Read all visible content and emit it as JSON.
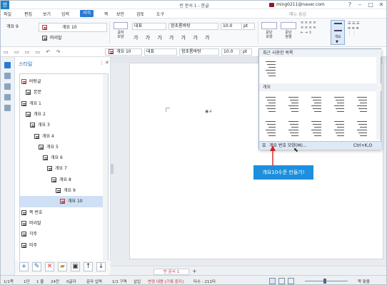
{
  "window": {
    "title": "빈 문서 1 - 한글",
    "user": "ming0211@naver.com",
    "app_logo": "한"
  },
  "menus": [
    "파일",
    "편집",
    "보기",
    "입력",
    "서식",
    "쪽",
    "보안",
    "검토",
    "도구"
  ],
  "menu_active": "서식",
  "collapse_label": "메뉴 숨김",
  "ribbon": {
    "outline_level": "개요 9",
    "style_selected": "개요 10",
    "style_second": "머리말",
    "char_shape_label": "글자\n모양",
    "font_lang": "대표",
    "font_name": "함초롬바탕",
    "font_size": "10.0",
    "font_unit": "pt",
    "para_shape_label": "문단\n모양",
    "para_align_label": "문단\n정렬",
    "outline_btn_label": "개요"
  },
  "toolbar": {
    "style_box": "개요 10",
    "lang_box": "대표",
    "font_box": "함초롬바탕",
    "size_box": "10.0",
    "unit_box": "pt"
  },
  "style_panel": {
    "title": "스타일",
    "items": [
      {
        "label": "바탕글",
        "indent": 0
      },
      {
        "label": "본문",
        "indent": 6
      },
      {
        "label": "개요 1",
        "indent": 0
      },
      {
        "label": "개요 2",
        "indent": 6
      },
      {
        "label": "개요 3",
        "indent": 12
      },
      {
        "label": "개요 4",
        "indent": 18
      },
      {
        "label": "개요 5",
        "indent": 24
      },
      {
        "label": "개요 6",
        "indent": 30
      },
      {
        "label": "개요 7",
        "indent": 36
      },
      {
        "label": "개요 8",
        "indent": 42
      },
      {
        "label": "개요 9",
        "indent": 48
      },
      {
        "label": "개요 10",
        "indent": 54
      },
      {
        "label": "쪽 번호",
        "indent": 0
      },
      {
        "label": "머리말",
        "indent": 0
      },
      {
        "label": "각주",
        "indent": 0
      },
      {
        "label": "미주",
        "indent": 0
      }
    ],
    "selected_index": 11,
    "buttons": [
      "add-icon",
      "edit-icon",
      "delete-icon",
      "open-folder-icon",
      "save-icon",
      "move-up-icon",
      "move-down-icon"
    ]
  },
  "dropdown": {
    "recent_header": "최근 사용한 목록",
    "outline_header": "개요",
    "menu_item": "개요 번호 모양(M)...",
    "menu_shortcut": "Ctrl+K,O"
  },
  "callout": "개요10수준 만들기!",
  "tab": {
    "name": "빈 문서 1"
  },
  "status": {
    "page": "1/1쪽",
    "section": "1단",
    "line": "1 줄",
    "col": "24칸",
    "chars": "0글자",
    "input_mode": "문자 입력",
    "division": "1/1 구역",
    "insert": "삽입",
    "track": "변경 내용 [기록 중지]",
    "count": "타수 : 211타",
    "zoom": "쪽 맞춤"
  },
  "colors": {
    "accent": "#2b7bd3",
    "callout": "#1d8fde",
    "arrow": "#d32020",
    "selected": "#cfe0f4"
  }
}
